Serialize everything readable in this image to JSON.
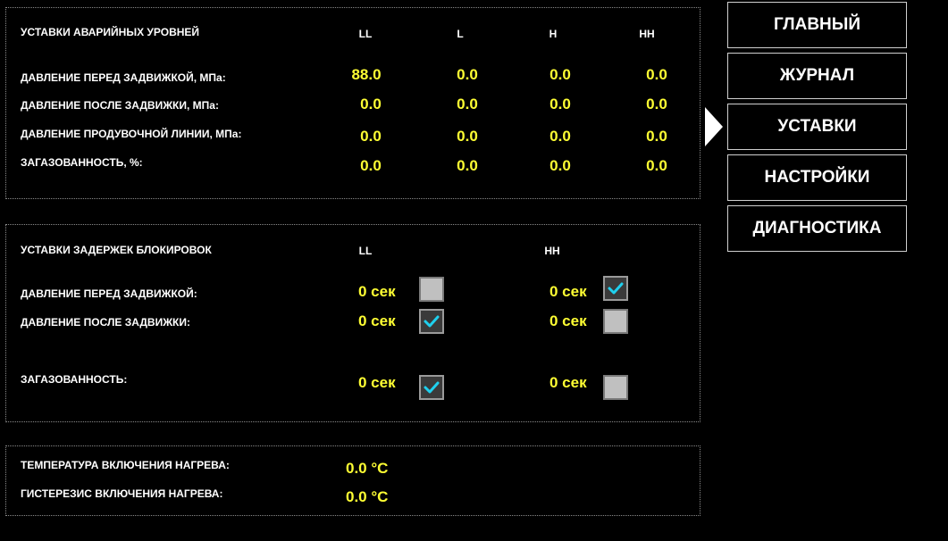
{
  "alarm_levels": {
    "title": "УСТАВКИ АВАРИЙНЫХ УРОВНЕЙ",
    "columns": [
      "LL",
      "L",
      "H",
      "HH"
    ],
    "rows": [
      {
        "label": "ДАВЛЕНИЕ ПЕРЕД ЗАДВИЖКОЙ, МПа:",
        "values": [
          "88.0",
          "0.0",
          "0.0",
          "0.0"
        ]
      },
      {
        "label": "ДАВЛЕНИЕ ПОСЛЕ ЗАДВИЖКИ, МПа:",
        "values": [
          "0.0",
          "0.0",
          "0.0",
          "0.0"
        ]
      },
      {
        "label": "ДАВЛЕНИЕ ПРОДУВОЧНОЙ ЛИНИИ, МПа:",
        "values": [
          "0.0",
          "0.0",
          "0.0",
          "0.0"
        ]
      },
      {
        "label": "ЗАГАЗОВАННОСТЬ, %:",
        "values": [
          "0.0",
          "0.0",
          "0.0",
          "0.0"
        ]
      }
    ]
  },
  "block_delays": {
    "title": "УСТАВКИ ЗАДЕРЖЕК БЛОКИРОВОК",
    "columns": [
      "LL",
      "HH"
    ],
    "rows": [
      {
        "label": "ДАВЛЕНИЕ ПЕРЕД ЗАДВИЖКОЙ:",
        "ll": "0 сек",
        "ll_checked": false,
        "hh": "0 сек",
        "hh_checked": true
      },
      {
        "label": "ДАВЛЕНИЕ ПОСЛЕ ЗАДВИЖКИ:",
        "ll": "0 сек",
        "ll_checked": true,
        "hh": "0 сек",
        "hh_checked": false
      },
      {
        "label": "ЗАГАЗОВАННОСТЬ:",
        "ll": "0 сек",
        "ll_checked": true,
        "hh": "0 сек",
        "hh_checked": false
      }
    ]
  },
  "heating": {
    "rows": [
      {
        "label": "ТЕМПЕРАТУРА ВКЛЮЧЕНИЯ НАГРЕВА:",
        "value": "0.0 °C"
      },
      {
        "label": "ГИСТЕРЕЗИС ВКЛЮЧЕНИЯ НАГРЕВА:",
        "value": "0.0 °C"
      }
    ]
  },
  "nav": {
    "items": [
      "ГЛАВНЫЙ",
      "ЖУРНАЛ",
      "УСТАВКИ",
      "НАСТРОЙКИ",
      "ДИАГНОСТИКА"
    ],
    "active_index": 2
  },
  "colors": {
    "value": "#ffff33",
    "check": "#1fd0ee",
    "background": "#000000"
  },
  "icons": {
    "checkmark": "checkmark-icon",
    "active_pointer": "active-arrow-icon"
  }
}
